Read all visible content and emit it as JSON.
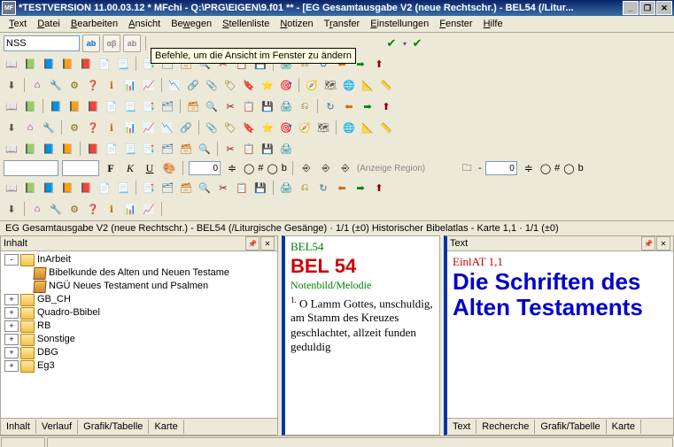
{
  "window": {
    "title": "*TESTVERSION 11.00.03.12 * MFchi - Q:\\PRG\\EIGEN\\9.f01 ** - [EG Gesamtausgabe V2 (neue Rechtschr.) - BEL54 (/Litur...",
    "appicon_text": "MF"
  },
  "menu": {
    "items": [
      "Text",
      "Datei",
      "Bearbeiten",
      "Ansicht",
      "Bewegen",
      "Stellenliste",
      "Notizen",
      "Transfer",
      "Einstellungen",
      "Fenster",
      "Hilfe"
    ]
  },
  "search": {
    "value": "NSS"
  },
  "tooltip": "Befehle, um die Ansicht im Fenster zu ändern",
  "format": {
    "region_label": "(Anzeige Region)",
    "num1": "0",
    "num2": "0",
    "hash": "#",
    "circle": "◯",
    "b": "b"
  },
  "breadcrumb": "EG Gesamtausgabe V2 (neue Rechtschr.) - BEL54 (/Liturgische Gesänge)  ·  1/1 (±0)   Historischer Bibelatlas - Karte 1,1  ·  1/1 (±0)",
  "left": {
    "title": "Inhalt",
    "tree": [
      {
        "indent": 0,
        "tw": "-",
        "icon": "folder",
        "label": "InArbeit"
      },
      {
        "indent": 1,
        "tw": "",
        "icon": "book",
        "label": "Bibelkunde des Alten und Neuen Testame"
      },
      {
        "indent": 1,
        "tw": "",
        "icon": "book",
        "label": "NGÜ Neues Testament und Psalmen"
      },
      {
        "indent": 0,
        "tw": "+",
        "icon": "folder",
        "label": "GB_CH"
      },
      {
        "indent": 0,
        "tw": "+",
        "icon": "folder",
        "label": "Quadro-Bbibel"
      },
      {
        "indent": 0,
        "tw": "+",
        "icon": "folder",
        "label": "RB"
      },
      {
        "indent": 0,
        "tw": "+",
        "icon": "folder",
        "label": "Sonstige"
      },
      {
        "indent": 0,
        "tw": "+",
        "icon": "folder",
        "label": "DBG"
      },
      {
        "indent": 0,
        "tw": "+",
        "icon": "folder",
        "label": "Eg3"
      }
    ],
    "tabs": [
      "Inhalt",
      "Verlauf",
      "Grafik/Tabelle",
      "Karte"
    ]
  },
  "mid": {
    "ref": "BEL54",
    "heading": "BEL 54",
    "subtitle": "Notenbild/Melodie",
    "verse_num": "1.",
    "body": "O Lamm Gottes, unschuldig, am Stamm des Kreuzes geschlachtet, allzeit funden geduldig"
  },
  "right": {
    "title": "Text",
    "ref": "EinlAT 1,1",
    "heading": "Die Schriften des Alten Testaments",
    "tabs": [
      "Text",
      "Recherche",
      "Grafik/Tabelle",
      "Karte"
    ]
  }
}
